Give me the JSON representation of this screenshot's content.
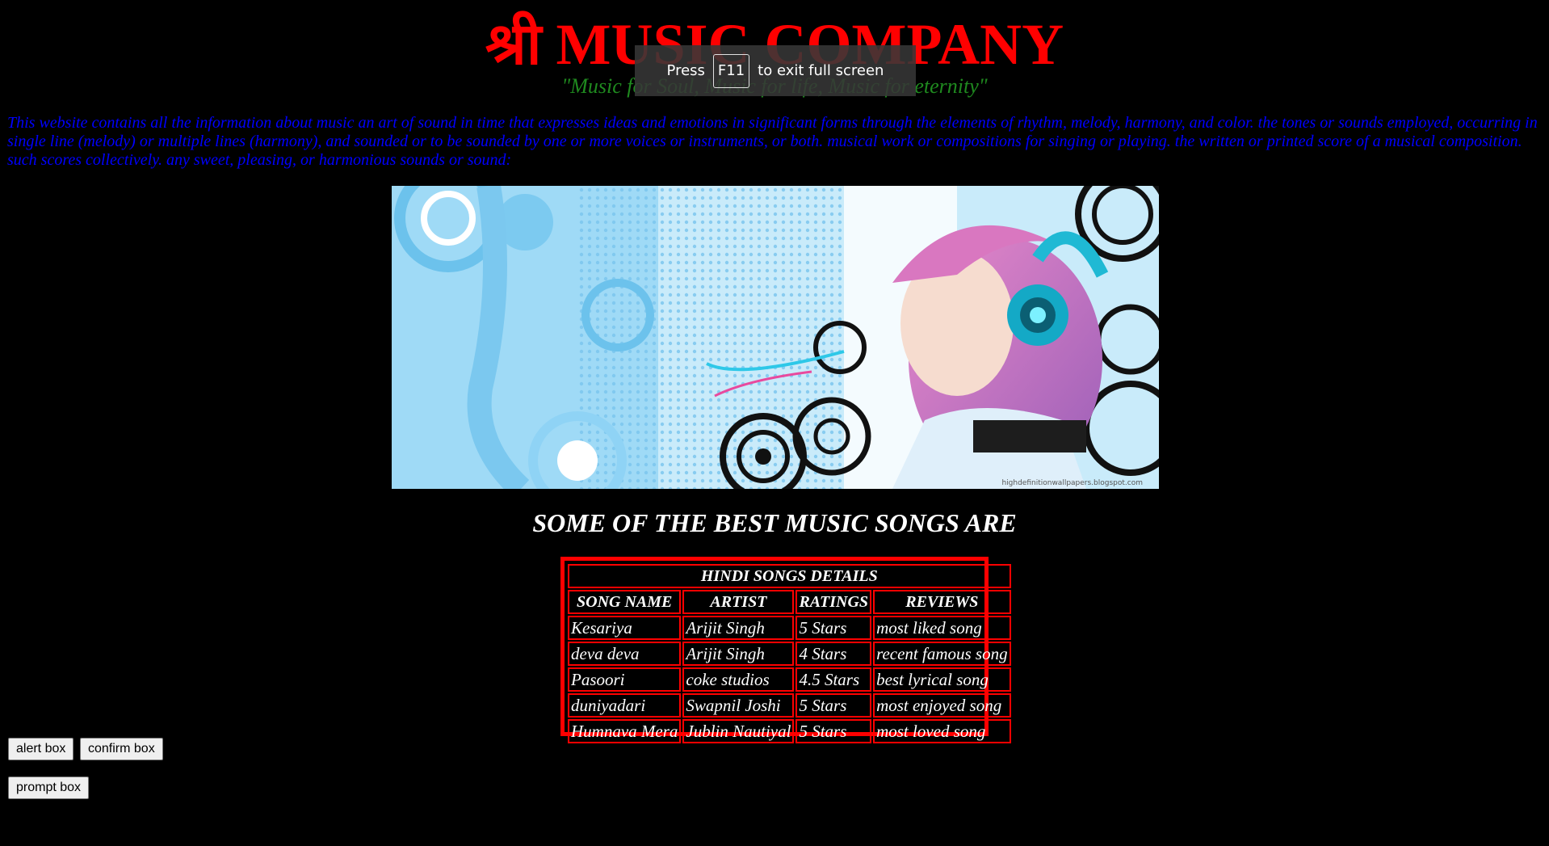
{
  "header": {
    "title": "श्री MUSIC COMPANY",
    "tagline": "\"Music for Soul, Music for life, Music for eternity\""
  },
  "intro": {
    "text": "This website contains all the information about music an art of sound in time that expresses ideas and emotions in significant forms through the elements of rhythm, melody, harmony, and color. the tones or sounds employed, occurring in single line (melody) or multiple lines (harmony), and sounded or to be sounded by one or more voices or instruments, or both. musical work or compositions for singing or playing. the written or printed score of a musical composition. such scores collectively. any sweet, pleasing, or harmonious sounds or sound:"
  },
  "banner": {
    "watermark": "highdefinitionwallpapers.blogspot.com"
  },
  "section": {
    "heading": "SOME OF THE BEST MUSIC SONGS ARE"
  },
  "table": {
    "caption": "HINDI SONGS DETAILS",
    "headers": [
      "SONG NAME",
      "ARTIST",
      "RATINGS",
      "REVIEWS"
    ],
    "rows": [
      [
        "Kesariya",
        "Arijit Singh",
        "5 Stars",
        "most liked song"
      ],
      [
        "deva deva",
        "Arijit Singh",
        "4 Stars",
        "recent famous song"
      ],
      [
        "Pasoori",
        "coke studios",
        "4.5 Stars",
        "best lyrical song"
      ],
      [
        "duniyadari",
        "Swapnil Joshi",
        "5 Stars",
        "most enjoyed song"
      ],
      [
        "Humnava Mera",
        "Jublin Nautiyal",
        "5 Stars",
        "most loved song"
      ]
    ]
  },
  "buttons": {
    "alert": "alert box",
    "confirm": "confirm box",
    "prompt": "prompt box"
  },
  "fullscreen_notice": {
    "press": "Press",
    "key": "F11",
    "rest": "to exit full screen"
  },
  "colors": {
    "background": "#000000",
    "title": "#ff0000",
    "tagline": "#1f8a1f",
    "intro": "#0000ff",
    "table_border": "#ff0000",
    "table_text": "#ffffff"
  }
}
